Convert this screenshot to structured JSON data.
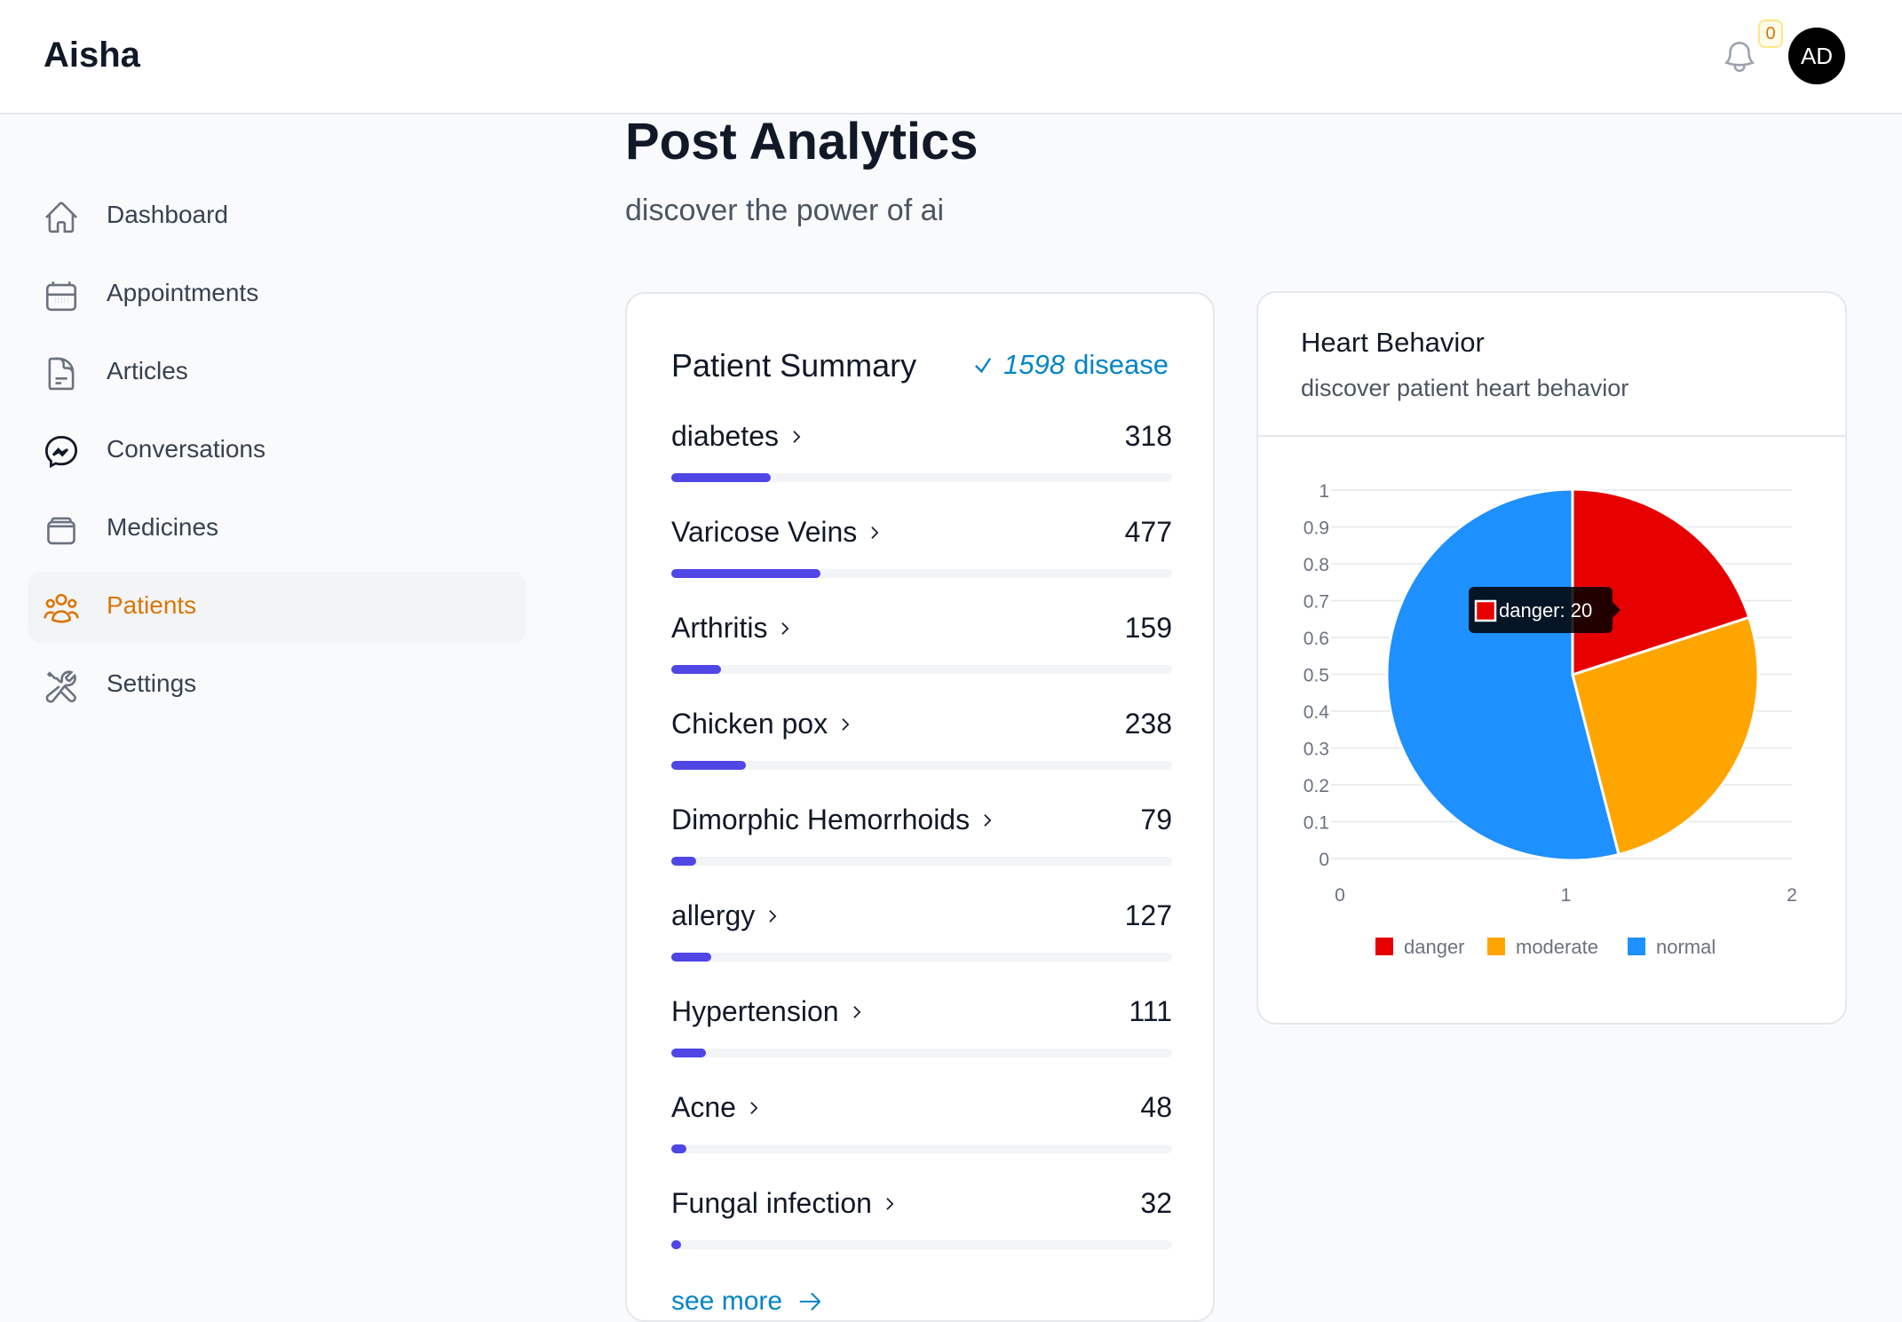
{
  "app": {
    "brand": "Aisha"
  },
  "header": {
    "notification_count": "0",
    "avatar_initials": "AD"
  },
  "sidebar": {
    "items": [
      {
        "label": "Dashboard",
        "icon": "home-icon",
        "active": false
      },
      {
        "label": "Appointments",
        "icon": "calendar-icon",
        "active": false
      },
      {
        "label": "Articles",
        "icon": "document-icon",
        "active": false
      },
      {
        "label": "Conversations",
        "icon": "messenger-icon",
        "active": false
      },
      {
        "label": "Medicines",
        "icon": "archive-icon",
        "active": false
      },
      {
        "label": "Patients",
        "icon": "users-icon",
        "active": true
      },
      {
        "label": "Settings",
        "icon": "tools-icon",
        "active": false
      }
    ]
  },
  "main": {
    "title": "Post Analytics",
    "subtitle": "discover the power of ai"
  },
  "summary": {
    "title": "Patient Summary",
    "total": "1598",
    "total_label": "disease",
    "see_more": "see more",
    "max_scale": 1598,
    "rows": [
      {
        "name": "diabetes",
        "count": 318
      },
      {
        "name": "Varicose Veins",
        "count": 477
      },
      {
        "name": "Arthritis",
        "count": 159
      },
      {
        "name": "Chicken pox",
        "count": 238
      },
      {
        "name": "Dimorphic Hemorrhoids",
        "count": 79
      },
      {
        "name": "allergy",
        "count": 127
      },
      {
        "name": "Hypertension",
        "count": 111
      },
      {
        "name": "Acne",
        "count": 48
      },
      {
        "name": "Fungal infection",
        "count": 32
      }
    ]
  },
  "heart": {
    "title": "Heart Behavior",
    "subtitle": "discover patient heart behavior",
    "tooltip": "danger: 20"
  },
  "chart_data": {
    "type": "pie",
    "categories": [
      "danger",
      "moderate",
      "normal"
    ],
    "values": [
      20,
      26,
      54
    ],
    "colors": [
      "#e60000",
      "#ffa500",
      "#1e90ff"
    ],
    "x_ticks": [
      "0",
      "1",
      "2"
    ],
    "y_ticks": [
      "0",
      "0.1",
      "0.2",
      "0.3",
      "0.4",
      "0.5",
      "0.6",
      "0.7",
      "0.8",
      "0.9",
      "1"
    ],
    "legend_position": "bottom",
    "grid": true
  }
}
